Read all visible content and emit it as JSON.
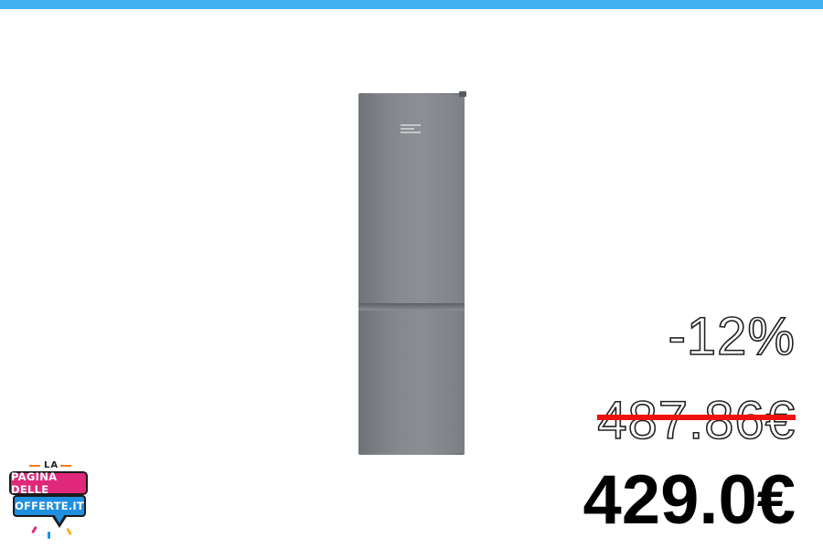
{
  "colors": {
    "top_bar": "#3fb0f0",
    "strike": "#ee1111",
    "logo_pink": "#e0287a",
    "logo_blue": "#1f8fe0"
  },
  "product": {
    "image": "fridge-image"
  },
  "pricing": {
    "discount": "-12%",
    "old_price": "487.86€",
    "new_price": "429.0€"
  },
  "logo": {
    "line1": "LA",
    "line2": "PAGINA DELLE",
    "line3": "OFFERTE.IT"
  }
}
